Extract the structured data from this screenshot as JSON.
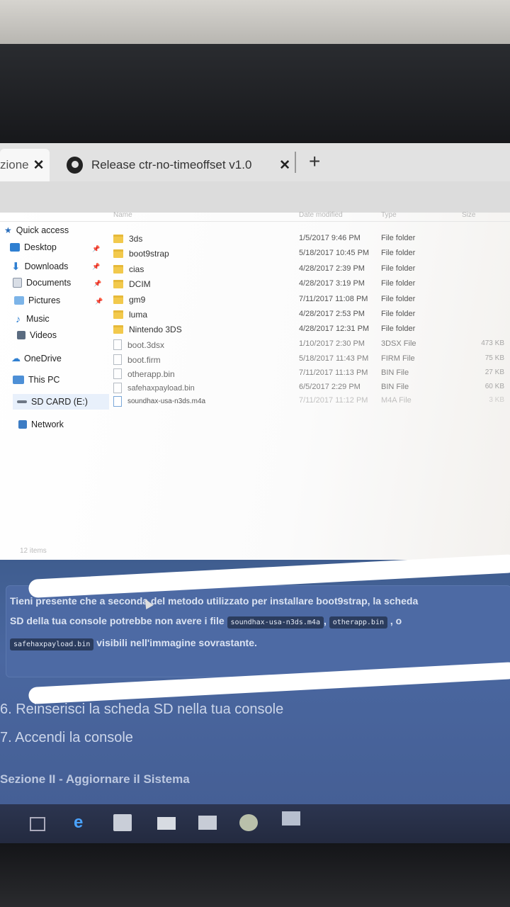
{
  "browser": {
    "tabs": [
      {
        "label": "zione",
        "active": true
      },
      {
        "label": "Release ctr-no-timeoffset v1.0",
        "active": false,
        "icon": "github-icon"
      }
    ],
    "close_symbol": "✕",
    "new_tab_symbol": "+"
  },
  "explorer": {
    "column_headers": [
      "Name",
      "Date modified",
      "Type",
      "Size"
    ],
    "nav": [
      {
        "label": "Quick access",
        "icon": "star-icon"
      },
      {
        "label": "Desktop",
        "icon": "desktop-icon",
        "pinned": true
      },
      {
        "label": "Downloads",
        "icon": "download-icon",
        "pinned": true
      },
      {
        "label": "Documents",
        "icon": "documents-icon",
        "pinned": true
      },
      {
        "label": "Pictures",
        "icon": "pictures-icon",
        "pinned": true
      },
      {
        "label": "Music",
        "icon": "music-icon"
      },
      {
        "label": "Videos",
        "icon": "videos-icon"
      },
      {
        "label": "OneDrive",
        "icon": "cloud-icon"
      },
      {
        "label": "This PC",
        "icon": "computer-icon"
      },
      {
        "label": "SD CARD (E:)",
        "icon": "drive-icon",
        "selected": true
      },
      {
        "label": "Network",
        "icon": "network-icon"
      }
    ],
    "files": [
      {
        "name": "3ds",
        "date": "1/5/2017 9:46 PM",
        "type": "File folder",
        "size": "",
        "kind": "folder"
      },
      {
        "name": "boot9strap",
        "date": "5/18/2017 10:45 PM",
        "type": "File folder",
        "size": "",
        "kind": "folder"
      },
      {
        "name": "cias",
        "date": "4/28/2017 2:39 PM",
        "type": "File folder",
        "size": "",
        "kind": "folder"
      },
      {
        "name": "DCIM",
        "date": "4/28/2017 3:19 PM",
        "type": "File folder",
        "size": "",
        "kind": "folder"
      },
      {
        "name": "gm9",
        "date": "7/11/2017 11:08 PM",
        "type": "File folder",
        "size": "",
        "kind": "folder"
      },
      {
        "name": "luma",
        "date": "4/28/2017 2:53 PM",
        "type": "File folder",
        "size": "",
        "kind": "folder"
      },
      {
        "name": "Nintendo 3DS",
        "date": "4/28/2017 12:31 PM",
        "type": "File folder",
        "size": "",
        "kind": "folder"
      },
      {
        "name": "boot.3dsx",
        "date": "1/10/2017 2:30 PM",
        "type": "3DSX File",
        "size": "473 KB",
        "kind": "file"
      },
      {
        "name": "boot.firm",
        "date": "5/18/2017 11:43 PM",
        "type": "FIRM File",
        "size": "75 KB",
        "kind": "file"
      },
      {
        "name": "otherapp.bin",
        "date": "7/11/2017 11:13 PM",
        "type": "BIN File",
        "size": "27 KB",
        "kind": "file"
      },
      {
        "name": "safehaxpayload.bin",
        "date": "6/5/2017 2:29 PM",
        "type": "BIN File",
        "size": "60 KB",
        "kind": "file"
      },
      {
        "name": "soundhax-usa-n3ds.m4a",
        "date": "7/11/2017 11:12 PM",
        "type": "M4A File",
        "size": "3 KB",
        "kind": "file"
      }
    ],
    "status": "12 items"
  },
  "page": {
    "notice": {
      "part1": "Tieni presente che a seconda del metodo utilizzato per installare boot9strap, la scheda",
      "part2": "SD della tua console potrebbe non avere i file",
      "code1": "soundhax-usa-n3ds.m4a",
      "sep1": ",",
      "code2": "otherapp.bin",
      "sep2": ", o",
      "code3": "safehaxpayload.bin",
      "part3": "visibili nell'immagine sovrastante."
    },
    "step6": "6. Reinserisci la scheda SD nella tua console",
    "step7": "7. Accendi la console",
    "section": "Sezione II - Aggiornare il Sistema"
  },
  "taskbar": {
    "icons": [
      "task-view-icon",
      "edge-icon",
      "store-icon",
      "mail-icon",
      "file-explorer-icon",
      "chrome-icon",
      "app-icon"
    ]
  }
}
